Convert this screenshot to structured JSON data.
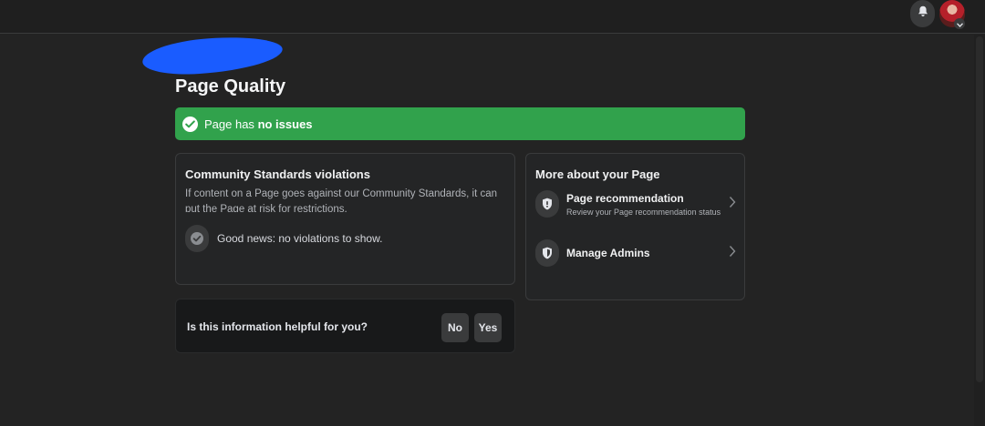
{
  "header": {
    "icons": {
      "notifications": "bell-icon",
      "account_menu": "chevron-down-icon"
    }
  },
  "page": {
    "title": "Page Quality"
  },
  "status_banner": {
    "prefix": "Page has",
    "emphasis": "no issues",
    "color": "#31a24c",
    "icon": "check-circle-icon"
  },
  "violations_card": {
    "heading": "Community Standards violations",
    "description": "If content on a Page goes against our Community Standards, it can put the Page at risk for restrictions.",
    "good_news": "Good news: no violations to show.",
    "icon": "check-circle-icon"
  },
  "more_card": {
    "heading": "More about your Page",
    "items": [
      {
        "title": "Page recommendation",
        "subtitle": "Review your Page recommendation status",
        "icon": "shield-icon"
      },
      {
        "title": "Manage Admins",
        "subtitle": "",
        "icon": "shield-icon"
      }
    ]
  },
  "feedback": {
    "question": "Is this information helpful for you?",
    "no_label": "No",
    "yes_label": "Yes"
  }
}
